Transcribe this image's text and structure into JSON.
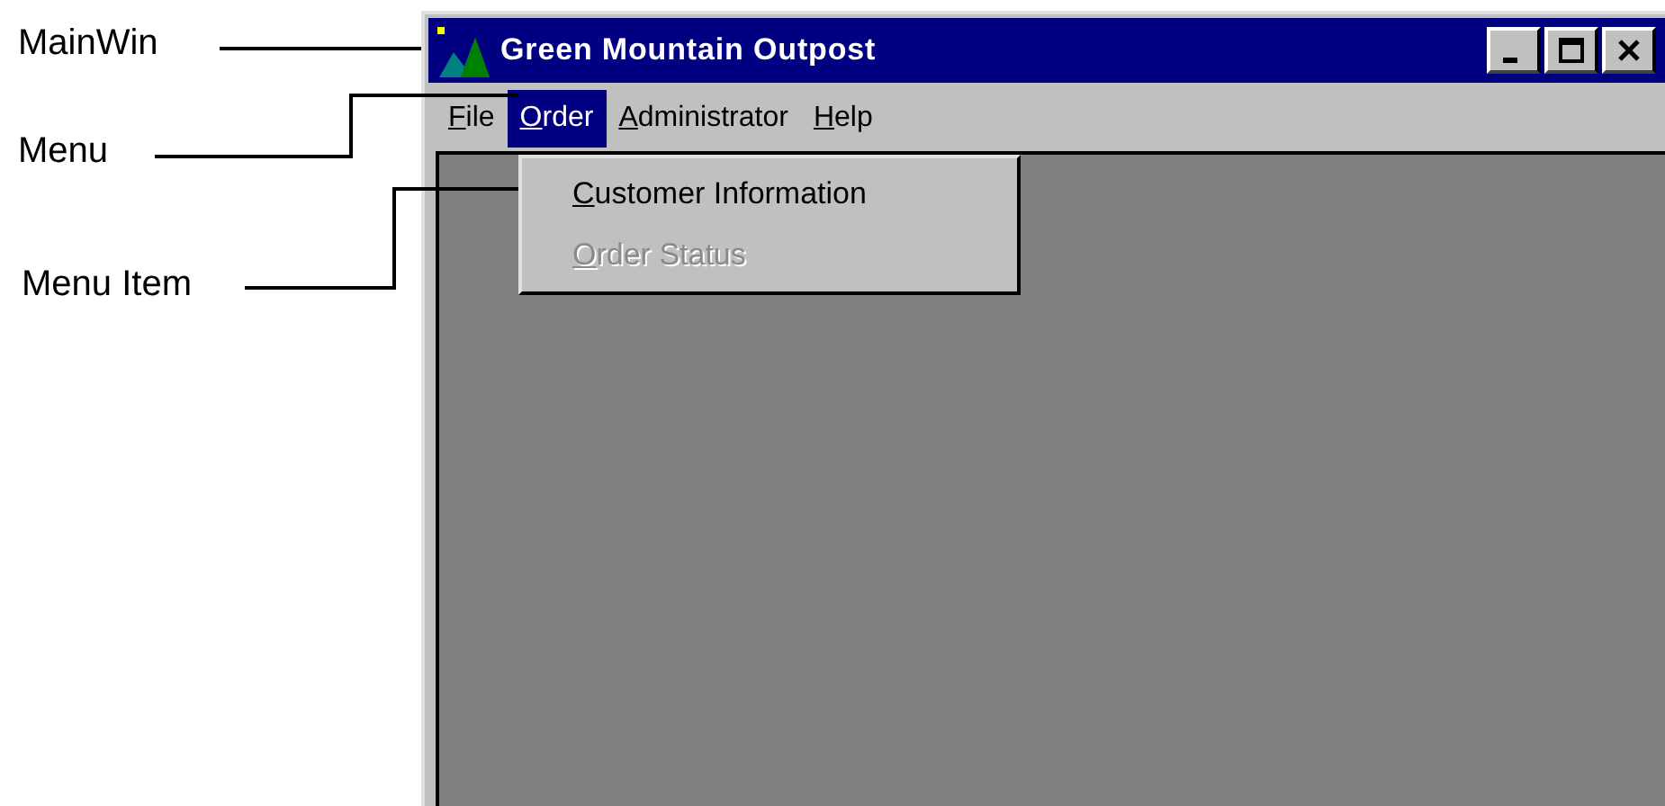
{
  "callouts": [
    "MainWin",
    "Menu",
    "Menu Item"
  ],
  "window": {
    "title": "Green Mountain Outpost"
  },
  "menu": [
    {
      "label": "File",
      "selected": false
    },
    {
      "label": "Order",
      "selected": true
    },
    {
      "label": "Administrator",
      "selected": false
    },
    {
      "label": "Help",
      "selected": false
    }
  ],
  "dropdown": [
    {
      "label": "Customer Information",
      "disabled": false
    },
    {
      "label": "Order Status",
      "disabled": true
    }
  ]
}
